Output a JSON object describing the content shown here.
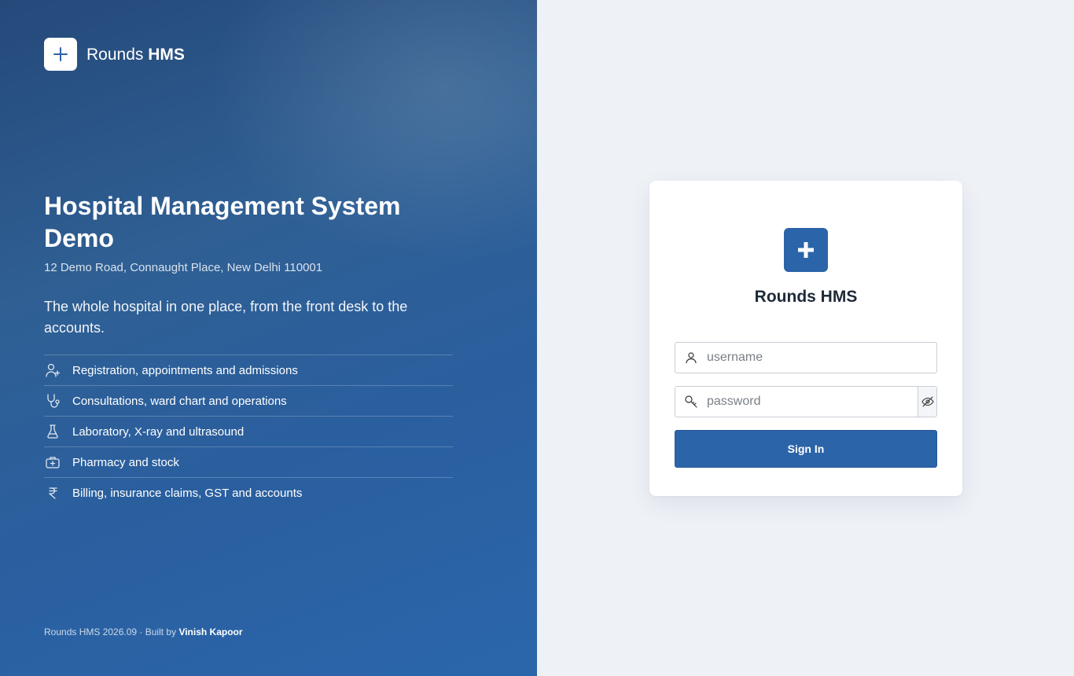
{
  "brand": {
    "name_light": "Rounds",
    "name_bold": "HMS"
  },
  "hero": {
    "title": "Hospital Management System Demo",
    "address": "12 Demo Road, Connaught Place, New Delhi 110001",
    "tagline": "The whole hospital in one place, from the front desk to the accounts."
  },
  "features": [
    {
      "icon": "user-plus-icon",
      "label": "Registration, appointments and admissions"
    },
    {
      "icon": "stethoscope-icon",
      "label": "Consultations, ward chart and operations"
    },
    {
      "icon": "flask-icon",
      "label": "Laboratory, X-ray and ultrasound"
    },
    {
      "icon": "medkit-icon",
      "label": "Pharmacy and stock"
    },
    {
      "icon": "rupee-icon",
      "label": "Billing, insurance claims, GST and accounts"
    }
  ],
  "footer": {
    "prefix": "Rounds HMS 2026.09 · Built by",
    "author": "Vinish Kapoor"
  },
  "login": {
    "title": "Rounds HMS",
    "username_placeholder": "username",
    "password_placeholder": "password",
    "submit_label": "Sign In"
  },
  "colors": {
    "primary": "#2b64a8",
    "panel_bg": "#eef1f6",
    "hero_dark": "#25497a",
    "hero_light": "#2b66ab"
  }
}
